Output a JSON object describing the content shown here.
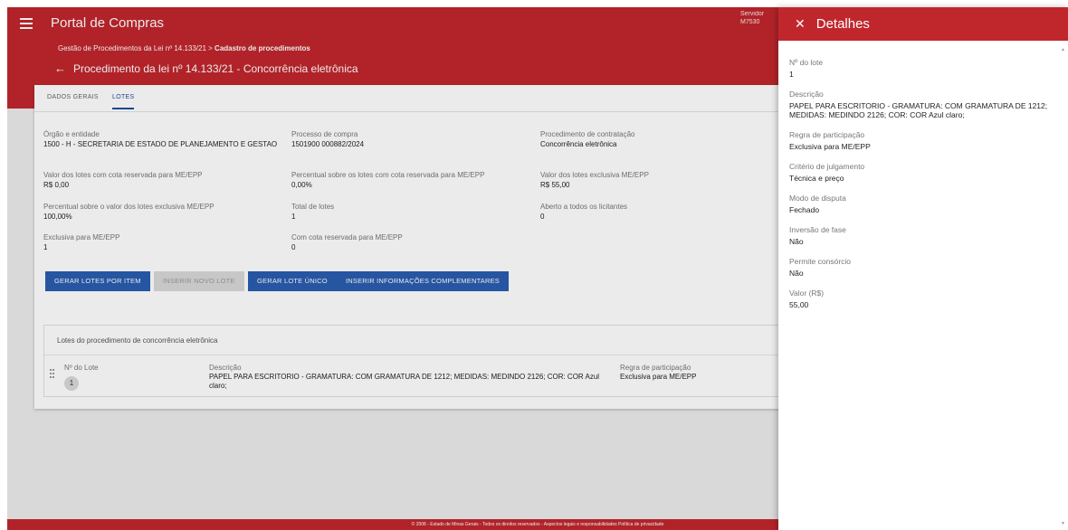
{
  "header": {
    "app_title": "Portal de Compras",
    "server_line1": "Servidor",
    "server_line2": "M7530",
    "breadcrumb_prefix": "Gestão de Procedimentos da Lei nº 14.133/21 > ",
    "breadcrumb_current": "Cadastro de procedimentos",
    "page_title": "Procedimento da lei nº 14.133/21 - Concorrência eletrônica"
  },
  "tabs": [
    {
      "label": "DADOS GERAIS"
    },
    {
      "label": "LOTES"
    }
  ],
  "fields": {
    "orgao": {
      "label": "Órgão e entidade",
      "value": "1500 - H - SECRETARIA DE ESTADO DE PLANEJAMENTO E GESTAO"
    },
    "processo": {
      "label": "Processo de compra",
      "value": "1501900 000882/2024"
    },
    "procedimento": {
      "label": "Procedimento de contratação",
      "value": "Concorrência eletrônica"
    },
    "valor_cota": {
      "label": "Valor dos lotes com cota reservada para ME/EPP",
      "value": "R$ 0,00"
    },
    "perc_cota": {
      "label": "Percentual sobre os lotes com cota reservada para ME/EPP",
      "value": "0,00%"
    },
    "valor_exclusiva": {
      "label": "Valor dos lotes exclusiva ME/EPP",
      "value": "R$ 55,00"
    },
    "perc_exclusiva": {
      "label": "Percentual sobre o valor dos lotes exclusiva ME/EPP",
      "value": "100,00%"
    },
    "total_lotes": {
      "label": "Total de lotes",
      "value": "1"
    },
    "aberto": {
      "label": "Aberto a todos os licitantes",
      "value": "0"
    },
    "exclusiva": {
      "label": "Exclusiva para ME/EPP",
      "value": "1"
    },
    "com_cota": {
      "label": "Com cota reservada para ME/EPP",
      "value": "0"
    }
  },
  "buttons": {
    "gerar_por_item": "GERAR LOTES POR ITEM",
    "inserir_novo": "INSERIR NOVO LOTE",
    "gerar_unico": "GERAR LOTE ÚNICO",
    "inserir_info": "INSERIR INFORMAÇÕES COMPLEMENTARES"
  },
  "lotes_table": {
    "title": "Lotes do procedimento de concorrência eletrônica",
    "columns": [
      "Nº do Lote",
      "Descrição",
      "Regra de participação"
    ],
    "rows": [
      {
        "numero": "1",
        "descricao": "PAPEL PARA ESCRITORIO - GRAMATURA: COM GRAMATURA DE 1212; MEDIDAS: MEDINDO 2126; COR: COR Azul claro;",
        "regra": "Exclusiva para ME/EPP"
      }
    ]
  },
  "footer": "© 2008 - Estado de Minas Gerais - Todos os direitos reservados - Aspectos legais e responsabilidades  Política de privacidade",
  "panel": {
    "title": "Detalhes",
    "fields": [
      {
        "label": "Nº do lote",
        "value": "1"
      },
      {
        "label": "Descrição",
        "value": "PAPEL PARA ESCRITORIO - GRAMATURA: COM GRAMATURA DE 1212; MEDIDAS: MEDINDO 2126; COR: COR Azul claro;"
      },
      {
        "label": "Regra de participação",
        "value": "Exclusiva para ME/EPP"
      },
      {
        "label": "Critério de julgamento",
        "value": "Técnica e preço"
      },
      {
        "label": "Modo de disputa",
        "value": "Fechado"
      },
      {
        "label": "Inversão de fase",
        "value": "Não"
      },
      {
        "label": "Permite consórcio",
        "value": "Não"
      },
      {
        "label": "Valor (R$)",
        "value": "55,00"
      }
    ]
  },
  "colors": {
    "brand_red": "#c0272d",
    "primary_blue": "#2a5db0"
  }
}
